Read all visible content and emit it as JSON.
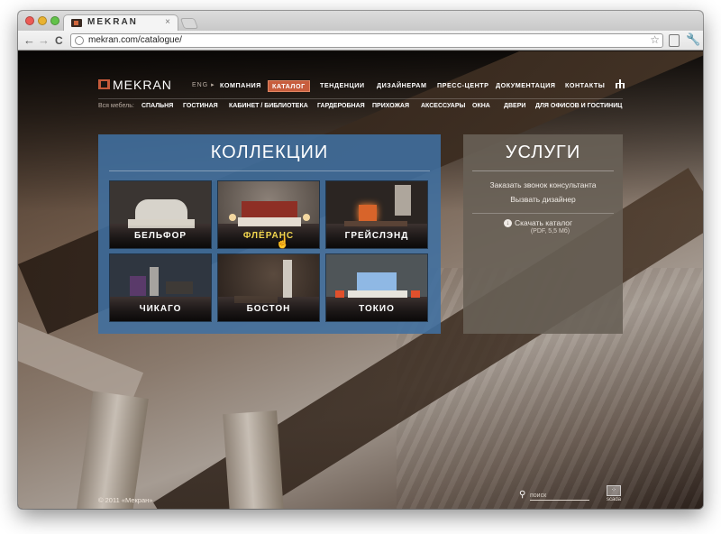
{
  "browser": {
    "tab_title": "MEKRAN",
    "tab_close": "×",
    "url": "mekran.com/catalogue/",
    "back": "←",
    "forward": "→",
    "reload": "C",
    "bookmark_star": "☆",
    "wrench": "🔧"
  },
  "header": {
    "logo_text": "MEKRAN",
    "lang": "ENG ▸",
    "nav": [
      {
        "label": "КОМПАНИЯ",
        "active": false
      },
      {
        "label": "КАТАЛОГ",
        "active": true
      },
      {
        "label": "ТЕНДЕНЦИИ",
        "active": false
      },
      {
        "label": "ДИЗАЙНЕРАМ",
        "active": false
      },
      {
        "label": "ПРЕСС-ЦЕНТР",
        "active": false
      },
      {
        "label": "ДОКУМЕНТАЦИЯ",
        "active": false
      },
      {
        "label": "КОНТАКТЫ",
        "active": false
      }
    ],
    "subnav_prefix": "Вся мебель:",
    "subnav": [
      "СПАЛЬНЯ",
      "ГОСТИНАЯ",
      "КАБИНЕТ / БИБЛИОТЕКА",
      "ГАРДЕРОБНАЯ",
      "ПРИХОЖАЯ",
      "АКСЕССУАРЫ",
      "ОКНА",
      "ДВЕРИ",
      "ДЛЯ ОФИСОВ И ГОСТИНИЦ"
    ]
  },
  "collections": {
    "title": "КОЛЛЕКЦИИ",
    "items": [
      {
        "label": "БЕЛЬФОР",
        "hover": false,
        "wall": "#3a3532",
        "accent": "#e9e4dc"
      },
      {
        "label": "ФЛЁРАНС",
        "hover": true,
        "wall": "#6a605a",
        "accent": "#8e2f25"
      },
      {
        "label": "ГРЕЙСЛЭНД",
        "hover": false,
        "wall": "#2b2522",
        "accent": "#d8642a"
      },
      {
        "label": "ЧИКАГО",
        "hover": false,
        "wall": "#2f3640",
        "accent": "#5a3a6a"
      },
      {
        "label": "БОСТОН",
        "hover": false,
        "wall": "#3c322b",
        "accent": "#cfc9c0"
      },
      {
        "label": "ТОКИО",
        "hover": false,
        "wall": "#4f5558",
        "accent": "#8fb8e4"
      }
    ]
  },
  "services": {
    "title": "УСЛУГИ",
    "links": [
      "Заказать звонок консультанта",
      "Вызвать дизайнер"
    ],
    "download_label": "Скачать каталог",
    "download_meta": "(PDF, 5,5 Мб)"
  },
  "footer": {
    "copyright": "© 2011 «Мекран»",
    "search_placeholder": "поиск",
    "scada_label": "scada"
  },
  "colors": {
    "accent_orange": "#c75d3d",
    "collections_panel": "#4070a0",
    "services_panel": "#685f56",
    "hover_label": "#f1d54e"
  }
}
